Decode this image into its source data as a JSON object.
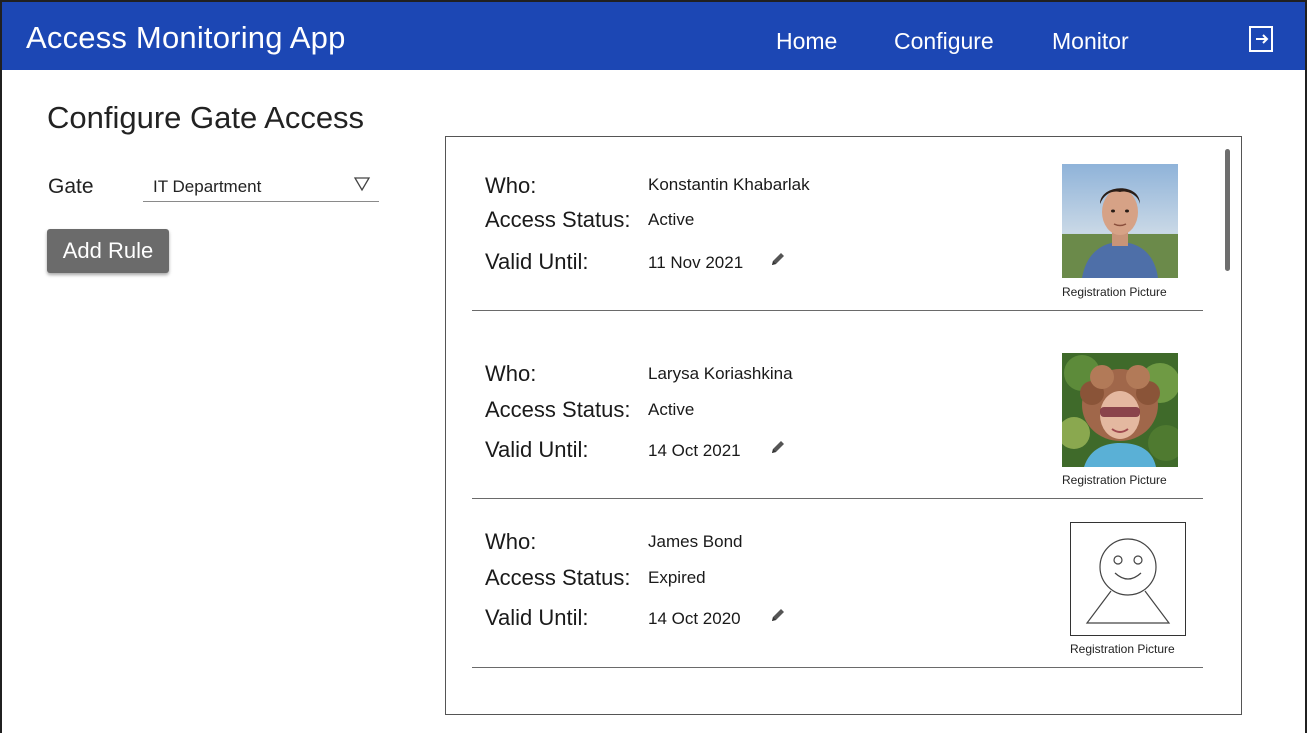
{
  "app": {
    "title": "Access Monitoring App",
    "accent_color": "#1c47b4"
  },
  "nav": {
    "items": [
      {
        "label": "Home"
      },
      {
        "label": "Configure"
      },
      {
        "label": "Monitor"
      }
    ],
    "logout_icon": "logout-icon"
  },
  "page": {
    "title": "Configure Gate Access",
    "gate_label": "Gate",
    "gate_value": "IT Department",
    "add_rule_label": "Add Rule"
  },
  "labels": {
    "who": "Who:",
    "status": "Access Status:",
    "valid": "Valid Until:",
    "caption": "Registration Picture"
  },
  "rules": [
    {
      "who": "Konstantin Khabarlak",
      "status": "Active",
      "valid_until": "11 Nov 2021",
      "picture": "photo-man"
    },
    {
      "who": "Larysa Koriashkina",
      "status": "Active",
      "valid_until": "14 Oct 2021",
      "picture": "photo-woman"
    },
    {
      "who": "James Bond",
      "status": "Expired",
      "valid_until": "14 Oct 2020",
      "picture": "placeholder-face"
    }
  ]
}
